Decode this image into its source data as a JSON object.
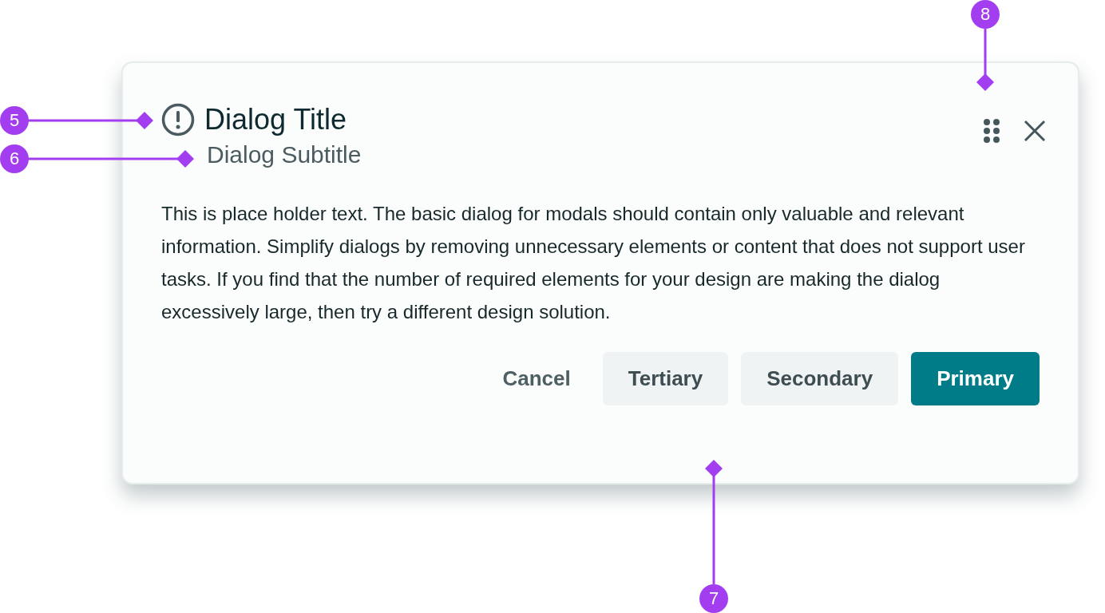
{
  "dialog": {
    "title": "Dialog Title",
    "subtitle": "Dialog Subtitle",
    "body": "This is place holder text. The basic dialog for modals should contain only valuable and relevant information. Simplify dialogs by removing unnecessary elements or content that does not support user tasks. If you find that the number of required elements for your design are making the dialog excessively large, then try a different design solution.",
    "buttons": [
      {
        "label": "Cancel",
        "kind": "text"
      },
      {
        "label": "Tertiary",
        "kind": "tertiary"
      },
      {
        "label": "Secondary",
        "kind": "secondary"
      },
      {
        "label": "Primary",
        "kind": "primary"
      }
    ]
  },
  "annotations": [
    {
      "label": "5"
    },
    {
      "label": "6"
    },
    {
      "label": "7"
    },
    {
      "label": "8"
    }
  ]
}
